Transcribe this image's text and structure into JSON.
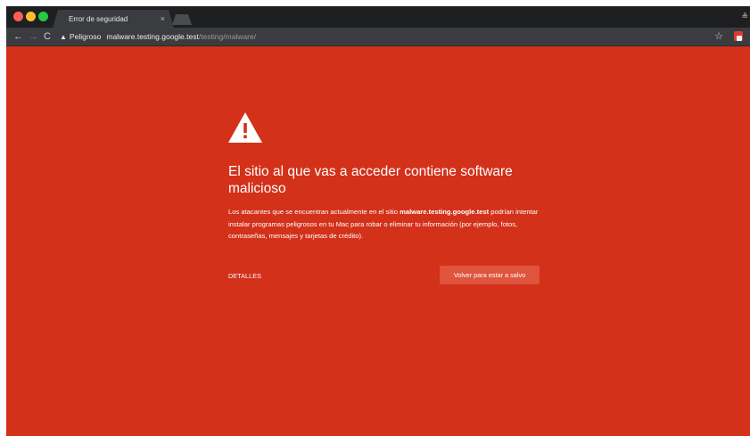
{
  "tab": {
    "title": "Error de seguridad",
    "close_glyph": "×"
  },
  "toolbar": {
    "back_glyph": "←",
    "forward_glyph": "→",
    "reload_glyph": "C",
    "status": "Peligroso",
    "url_host": "malware.testing.google.test",
    "url_path": "/testing/malware/",
    "bookmark_glyph": "☆"
  },
  "page": {
    "heading": "El sitio al que vas a acceder contiene software malicioso",
    "body_before": "Los atacantes que se encuentran actualmente en el sitio ",
    "body_site": "malware.testing.google.test",
    "body_after": " podrían intentar instalar programas peligrosos en tu Mac para robar o eliminar tu información (por ejemplo, fotos, contraseñas, mensajes y tarjetas de crédito).",
    "details_label": "DETALLES",
    "primary_button_label": "Volver para estar a salvo"
  },
  "icons": {
    "hazard": "warning-triangle-icon",
    "omnibox": "warning-icon"
  },
  "colors": {
    "danger_background": "#d33119",
    "button_background": "#e0533c",
    "tabstrip": "#1e1f21",
    "toolbar": "#3b3c3f"
  }
}
